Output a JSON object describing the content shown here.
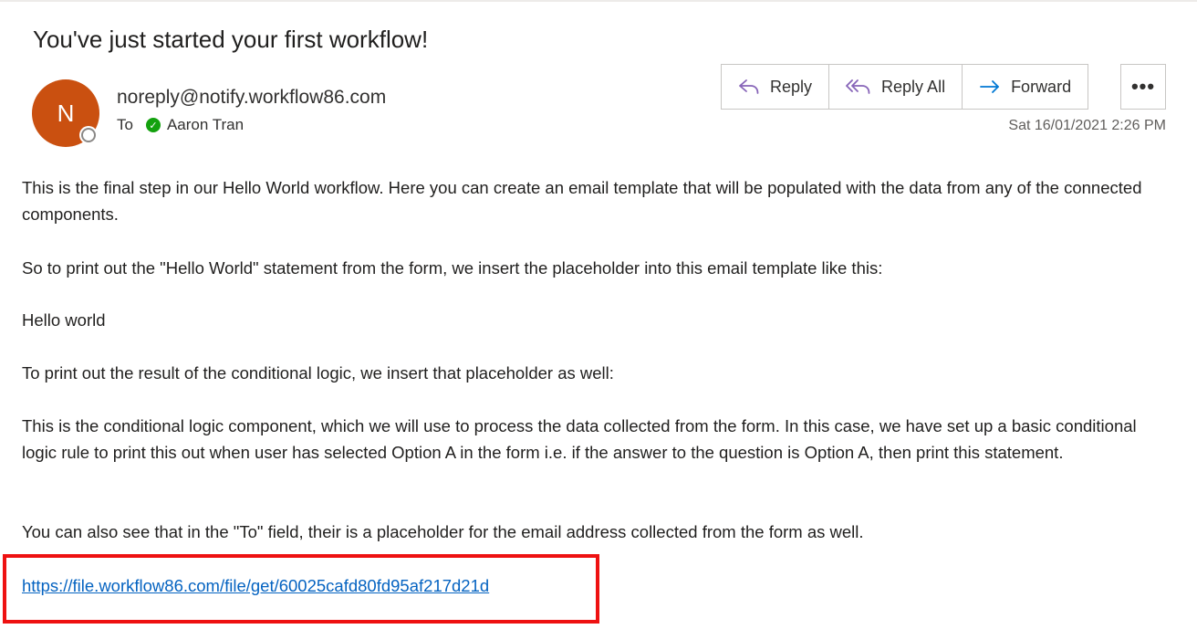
{
  "email": {
    "subject": "You've just started your first workflow!",
    "sender_initial": "N",
    "sender": "noreply@notify.workflow86.com",
    "to_label": "To",
    "recipient": "Aaron Tran",
    "date": "Sat 16/01/2021 2:26 PM"
  },
  "actions": {
    "reply": "Reply",
    "reply_all": "Reply All",
    "forward": "Forward",
    "more": "•••"
  },
  "body": {
    "p1": "This is the final step in our Hello World workflow. Here you can create an email template that will be populated with the data from any of the connected components.",
    "p2": "So to print out the \"Hello World\" statement from the form, we insert the placeholder into this email template like this:",
    "p3": "Hello world",
    "p4": "To print out the result of the conditional logic, we insert that placeholder as well:",
    "p5": "This is the conditional logic component, which we will use to process the data collected from the form. In this case, we have set up a basic conditional logic rule to print this out when user has selected Option A in the form i.e. if the answer to the question is Option A, then print this statement.",
    "p6": "You can also see that in the \"To\" field, their is a placeholder for the email address collected from the form as well.",
    "link": "https://file.workflow86.com/file/get/60025cafd80fd95af217d21d"
  },
  "colors": {
    "avatar": "#ca5010",
    "link": "#0563c1",
    "highlight": "#ee1111",
    "reply_icon": "#8764b8",
    "forward_icon": "#0078d4",
    "verified": "#13a10e"
  },
  "icons": {
    "reply": "reply-icon",
    "reply_all": "reply-all-icon",
    "forward": "forward-icon",
    "more": "more-icon",
    "verified": "check-icon",
    "presence": "presence-icon"
  }
}
